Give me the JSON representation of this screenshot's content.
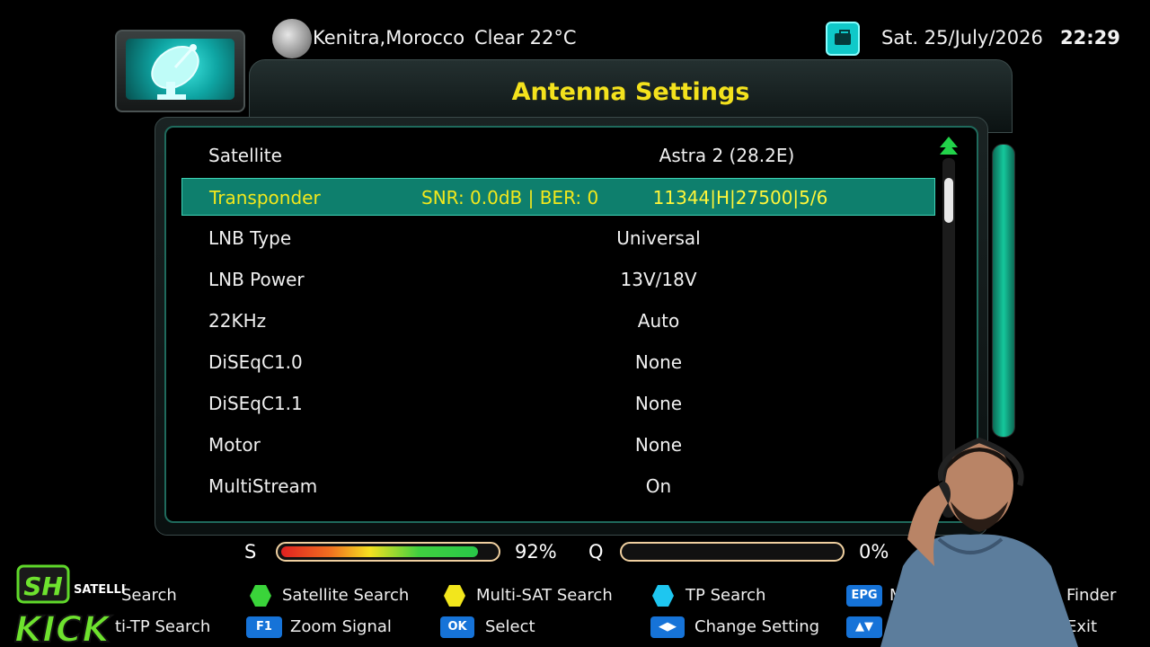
{
  "header": {
    "location": "Kenitra,Morocco",
    "weather": "Clear  22°C",
    "date": "Sat.  25/July/2026",
    "time": "22:29"
  },
  "page": {
    "title": "Antenna Settings"
  },
  "menu": {
    "rows": [
      {
        "label": "Satellite",
        "value": "Astra 2 (28.2E)"
      },
      {
        "label": "Transponder",
        "signal": "SNR: 0.0dB | BER: 0",
        "value": "11344|H|27500|5/6"
      },
      {
        "label": "LNB Type",
        "value": "Universal"
      },
      {
        "label": "LNB Power",
        "value": "13V/18V"
      },
      {
        "label": "22KHz",
        "value": "Auto"
      },
      {
        "label": "DiSEqC1.0",
        "value": "None"
      },
      {
        "label": "DiSEqC1.1",
        "value": "None"
      },
      {
        "label": "Motor",
        "value": "None"
      },
      {
        "label": "MultiStream",
        "value": "On"
      }
    ],
    "selected_index": 1
  },
  "signal": {
    "s_label": "S",
    "s_percent": "92%",
    "s_level": 0.92,
    "q_label": "Q",
    "q_percent": "0%",
    "q_level": 0.0
  },
  "footer": {
    "row1": [
      {
        "key": "red-hex",
        "label": "Search"
      },
      {
        "key": "green-hex",
        "label": "Satellite Search"
      },
      {
        "key": "yellow-hex",
        "label": "Multi-SAT Search"
      },
      {
        "key": "cyan-hex",
        "label": "TP Search"
      },
      {
        "key": "EPG",
        "label": "M"
      },
      {
        "key": "",
        "label": "Finder"
      }
    ],
    "row2": [
      {
        "key": "",
        "label": "ti-TP Search"
      },
      {
        "key": "F1",
        "label": "Zoom Signal"
      },
      {
        "key": "OK",
        "label": "Select"
      },
      {
        "key": "◀▶",
        "label": "Change Setting"
      },
      {
        "key": "▲▼",
        "label": ""
      },
      {
        "key": "",
        "label": "Exit"
      }
    ]
  },
  "overlay": {
    "brand_top": "SH",
    "brand_sub": "SATELLITE",
    "brand_main": "KICK"
  },
  "colors": {
    "title": "#f4e21d",
    "selected_row": "#0e7f6d",
    "accent": "#15c79c"
  }
}
